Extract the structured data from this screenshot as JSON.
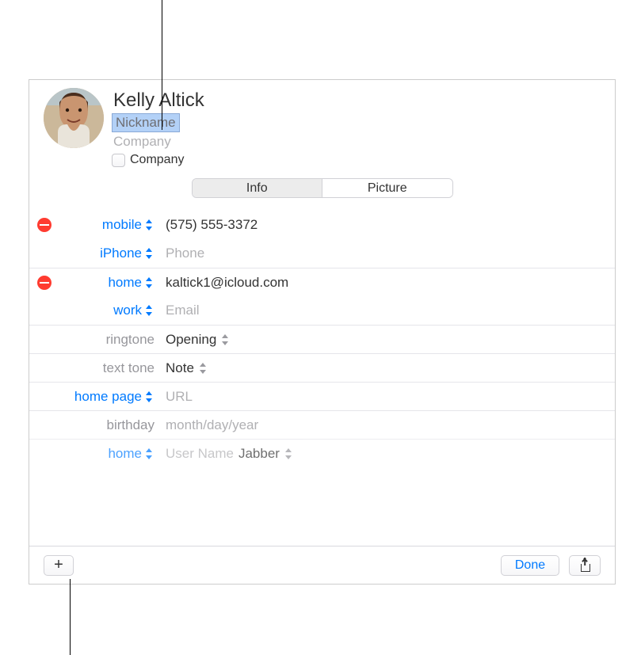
{
  "header": {
    "name": "Kelly  Altick",
    "nickname_placeholder": "Nickname",
    "company_placeholder": "Company",
    "company_checkbox_label": "Company"
  },
  "tabs": {
    "info": "Info",
    "picture": "Picture"
  },
  "rows": {
    "mobile_label": "mobile",
    "mobile_value": "(575) 555-3372",
    "iphone_label": "iPhone",
    "iphone_placeholder": "Phone",
    "home_email_label": "home",
    "home_email_value": "kaltick1@icloud.com",
    "work_email_label": "work",
    "work_email_placeholder": "Email",
    "ringtone_label": "ringtone",
    "ringtone_value": "Opening",
    "texttone_label": "text tone",
    "texttone_value": "Note",
    "homepage_label": "home page",
    "homepage_placeholder": "URL",
    "birthday_label": "birthday",
    "birthday_placeholder": "month/day/year",
    "im_label": "home",
    "im_user_placeholder": "User Name",
    "im_service_value": "Jabber"
  },
  "footer": {
    "done_label": "Done"
  }
}
